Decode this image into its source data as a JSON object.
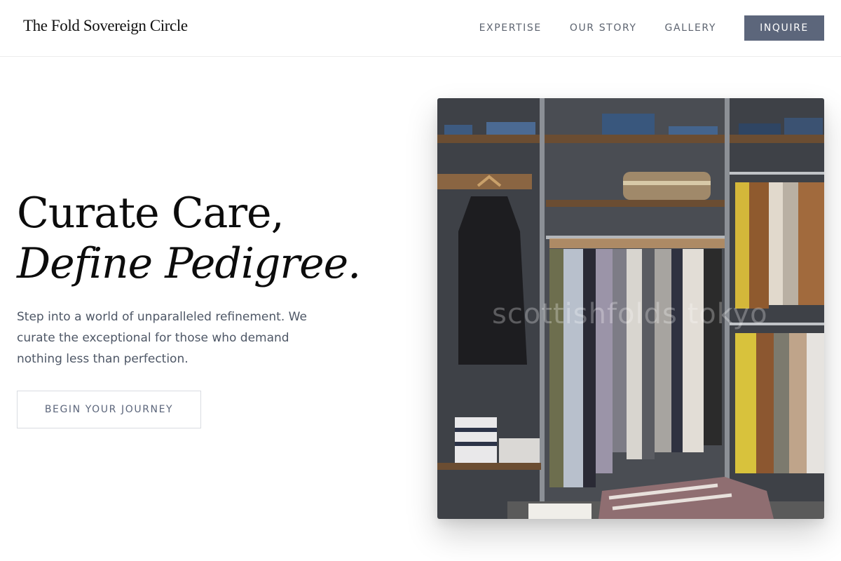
{
  "header": {
    "brand": "The Fold Sovereign Circle",
    "nav": [
      {
        "label": "EXPERTISE"
      },
      {
        "label": "OUR STORY"
      },
      {
        "label": "GALLERY"
      }
    ],
    "cta_label": "INQUIRE"
  },
  "hero": {
    "title_line1": "Curate Care,",
    "title_line2": "Define Pedigree.",
    "description": "Step into a world of unparalleled refinement. We curate the exceptional for those who demand nothing less than perfection.",
    "button_label": "BEGIN YOUR JOURNEY",
    "image": {
      "subject": "clothing-store-closet-photo",
      "watermark": "scottishfolds tokyo"
    }
  },
  "colors": {
    "accent": "#5c667b",
    "text_muted": "#4e5766",
    "border": "#d9dce1"
  }
}
